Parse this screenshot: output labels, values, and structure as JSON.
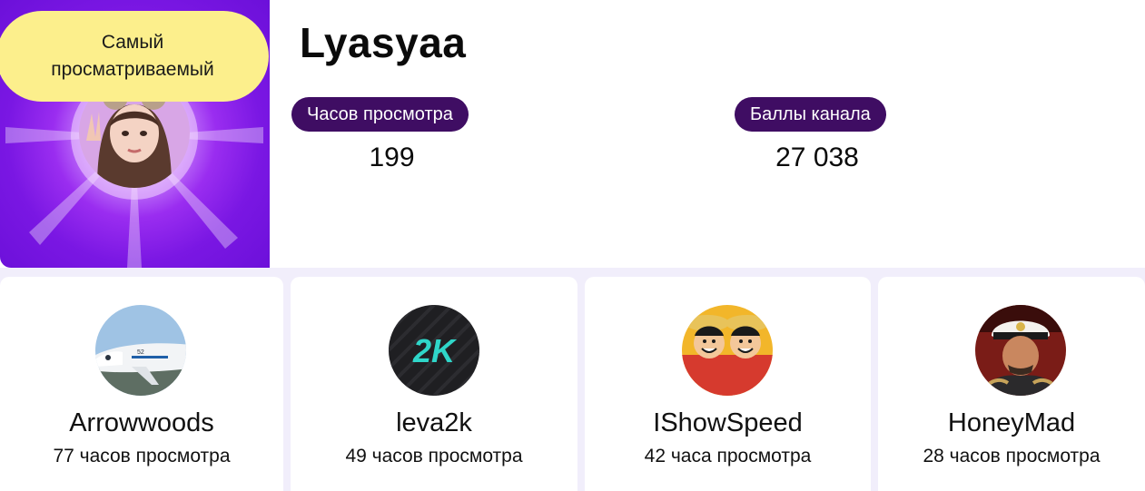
{
  "hero": {
    "badge": "Самый\nпросматриваемый",
    "username": "Lyasyaa",
    "stats": [
      {
        "label": "Часов просмотра",
        "value": "199"
      },
      {
        "label": "Баллы канала",
        "value": "27 038"
      }
    ]
  },
  "channels": [
    {
      "name": "Arrowwoods",
      "hours": "77 часов просмотра",
      "avatar": "airplane"
    },
    {
      "name": "leva2k",
      "hours": "49 часов просмотра",
      "avatar": "2k-logo"
    },
    {
      "name": "IShowSpeed",
      "hours": "42 часа просмотра",
      "avatar": "anime-characters"
    },
    {
      "name": "HoneyMad",
      "hours": "28 часов просмотра",
      "avatar": "captain-portrait"
    }
  ],
  "colors": {
    "hero_purple": "#7a17e3",
    "badge_yellow": "#fcef8c",
    "pill_purple": "#3f0d63",
    "page_background": "#f1eefb"
  }
}
